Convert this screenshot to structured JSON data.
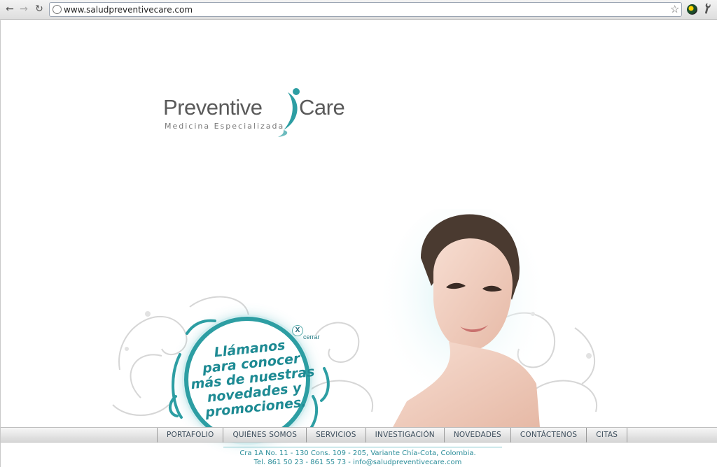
{
  "browser": {
    "url": "www.saludpreventivecare.com",
    "back_icon": "←",
    "forward_icon": "→",
    "reload_icon": "↻",
    "star_icon": "☆",
    "wrench_icon": "🔧"
  },
  "logo": {
    "word1": "Preventive",
    "word2": "Care",
    "tagline": "Medicina Especializada",
    "accent_color": "#2d9ea3"
  },
  "promo": {
    "lines": [
      "Llámanos",
      "para conocer",
      "más de nuestras",
      "novedades y",
      "promociones."
    ],
    "close_glyph": "X",
    "close_label": "cerrar",
    "color": "#1d8a93"
  },
  "menu": {
    "items": [
      "PORTAFOLIO",
      "QUIÉNES SOMOS",
      "SERVICIOS",
      "INVESTIGACIÓN",
      "NOVEDADES",
      "CONTÁCTENOS",
      "CITAS"
    ]
  },
  "footer": {
    "address": "Cra 1A No. 11 - 130 Cons. 109 - 205, Variante Chía-Cota, Colombia.",
    "contact": "Tel. 861 50 23 - 861 55 73 - info@saludpreventivecare.com"
  }
}
